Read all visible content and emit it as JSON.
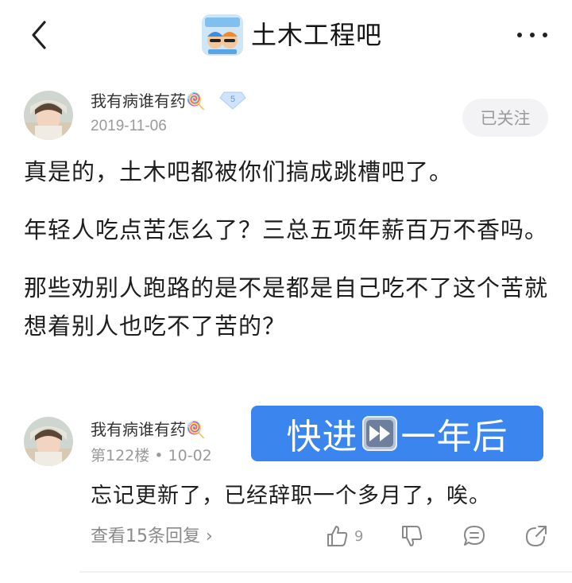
{
  "header": {
    "forum_title": "土木工程吧"
  },
  "post": {
    "author": "我有病谁有药🍭",
    "level": "5",
    "date": "2019-11-06",
    "follow_label": "已关注",
    "paragraphs": [
      "真是的，土木吧都被你们搞成跳槽吧了。",
      "年轻人吃点苦怎么了？三总五项年薪百万不香吗。",
      "那些劝别人跑路的是不是都是自己吃不了这个苦就想着别人也吃不了苦的？"
    ]
  },
  "reply": {
    "author": "我有病谁有药🍭",
    "floor_meta": "第122楼 • 10-02",
    "text": "忘记更新了，已经辞职一个多月了，唉。",
    "view_replies": "查看15条回复 ›",
    "like_count": "9"
  },
  "overlay": {
    "left_text": "快进",
    "right_text": "一年后"
  }
}
